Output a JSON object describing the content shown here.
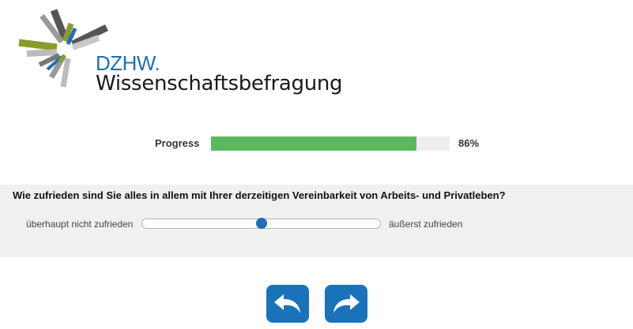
{
  "logo": {
    "brand": "DZHW.",
    "subtitle": "Wissenschaftsbefragung"
  },
  "progress": {
    "label": "Progress",
    "value_percent": 86,
    "value_text": "86%",
    "bar_color": "#5cb85c"
  },
  "question": {
    "text": "Wie zufrieden sind Sie alles in allem mit Ihrer derzeitigen Vereinbarkeit von Arbeits- und Privatleben?",
    "scale_min_label": "überhaupt nicht zufrieden",
    "scale_max_label": "äußerst zufrieden",
    "slider_value_fraction": 0.5
  },
  "navigation": {
    "back_icon": "back-arrow-icon",
    "next_icon": "forward-arrow-icon",
    "button_color": "#1a72bb"
  },
  "colors": {
    "accent": "#1f6fb6",
    "panel": "#f0f0f0"
  }
}
